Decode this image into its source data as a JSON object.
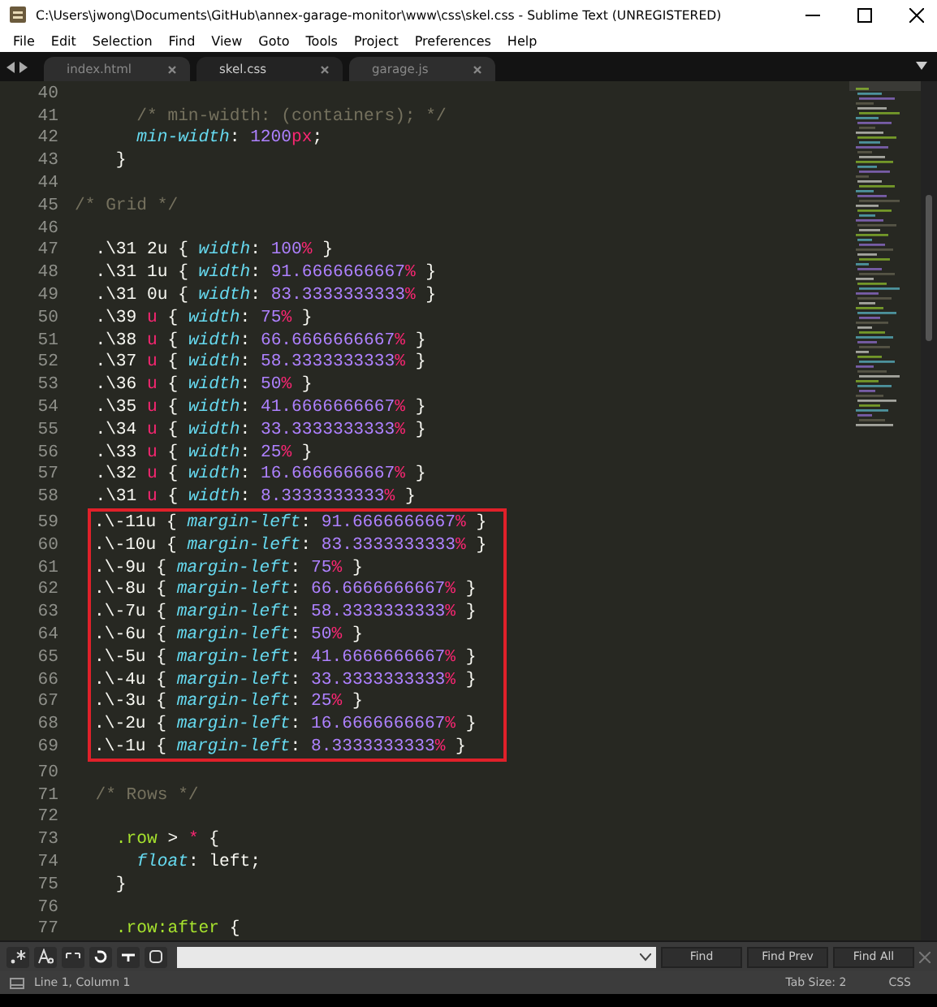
{
  "window": {
    "title": "C:\\Users\\jwong\\Documents\\GitHub\\annex-garage-monitor\\www\\css\\skel.css - Sublime Text (UNREGISTERED)"
  },
  "menu": [
    "File",
    "Edit",
    "Selection",
    "Find",
    "View",
    "Goto",
    "Tools",
    "Project",
    "Preferences",
    "Help"
  ],
  "tabs": [
    {
      "label": "index.html",
      "selected": false
    },
    {
      "label": "skel.css",
      "selected": true
    },
    {
      "label": "garage.js",
      "selected": false
    }
  ],
  "editor": {
    "lines": [
      {
        "number": "40",
        "boxed": false
      },
      {
        "number": "41",
        "boxed": false,
        "tokens": [
          {
            "kind": "comment",
            "text": "      /* min-width: (containers); */"
          }
        ]
      },
      {
        "number": "42",
        "boxed": false,
        "tokens": [
          {
            "kind": "property",
            "text": "      min-width"
          },
          {
            "kind": "plain",
            "text": ": "
          },
          {
            "kind": "number",
            "text": "1200"
          },
          {
            "kind": "unit",
            "text": "px"
          },
          {
            "kind": "plain",
            "text": ";"
          }
        ]
      },
      {
        "number": "43",
        "boxed": false,
        "tokens": [
          {
            "kind": "plain",
            "text": "    }"
          }
        ]
      },
      {
        "number": "44",
        "boxed": false
      },
      {
        "number": "45",
        "boxed": false,
        "tokens": [
          {
            "kind": "comment",
            "text": "/* Grid */"
          }
        ]
      },
      {
        "number": "46",
        "boxed": false
      },
      {
        "number": "47",
        "boxed": false,
        "tokens": [
          {
            "kind": "plain",
            "text": "  .\\31 2u { "
          },
          {
            "kind": "property",
            "text": "width"
          },
          {
            "kind": "plain",
            "text": ": "
          },
          {
            "kind": "number",
            "text": "100"
          },
          {
            "kind": "unit",
            "text": "%"
          },
          {
            "kind": "plain",
            "text": " }"
          }
        ]
      },
      {
        "number": "48",
        "boxed": false,
        "tokens": [
          {
            "kind": "plain",
            "text": "  .\\31 1u { "
          },
          {
            "kind": "property",
            "text": "width"
          },
          {
            "kind": "plain",
            "text": ": "
          },
          {
            "kind": "number",
            "text": "91.6666666667"
          },
          {
            "kind": "unit",
            "text": "%"
          },
          {
            "kind": "plain",
            "text": " }"
          }
        ]
      },
      {
        "number": "49",
        "boxed": false,
        "tokens": [
          {
            "kind": "plain",
            "text": "  .\\31 0u { "
          },
          {
            "kind": "property",
            "text": "width"
          },
          {
            "kind": "plain",
            "text": ": "
          },
          {
            "kind": "number",
            "text": "83.3333333333"
          },
          {
            "kind": "unit",
            "text": "%"
          },
          {
            "kind": "plain",
            "text": " }"
          }
        ]
      },
      {
        "number": "50",
        "boxed": false,
        "tokens": [
          {
            "kind": "plain",
            "text": "  .\\39 "
          },
          {
            "kind": "unit",
            "text": "u"
          },
          {
            "kind": "plain",
            "text": " { "
          },
          {
            "kind": "property",
            "text": "width"
          },
          {
            "kind": "plain",
            "text": ": "
          },
          {
            "kind": "number",
            "text": "75"
          },
          {
            "kind": "unit",
            "text": "%"
          },
          {
            "kind": "plain",
            "text": " }"
          }
        ]
      },
      {
        "number": "51",
        "boxed": false,
        "tokens": [
          {
            "kind": "plain",
            "text": "  .\\38 "
          },
          {
            "kind": "unit",
            "text": "u"
          },
          {
            "kind": "plain",
            "text": " { "
          },
          {
            "kind": "property",
            "text": "width"
          },
          {
            "kind": "plain",
            "text": ": "
          },
          {
            "kind": "number",
            "text": "66.6666666667"
          },
          {
            "kind": "unit",
            "text": "%"
          },
          {
            "kind": "plain",
            "text": " }"
          }
        ]
      },
      {
        "number": "52",
        "boxed": false,
        "tokens": [
          {
            "kind": "plain",
            "text": "  .\\37 "
          },
          {
            "kind": "unit",
            "text": "u"
          },
          {
            "kind": "plain",
            "text": " { "
          },
          {
            "kind": "property",
            "text": "width"
          },
          {
            "kind": "plain",
            "text": ": "
          },
          {
            "kind": "number",
            "text": "58.3333333333"
          },
          {
            "kind": "unit",
            "text": "%"
          },
          {
            "kind": "plain",
            "text": " }"
          }
        ]
      },
      {
        "number": "53",
        "boxed": false,
        "tokens": [
          {
            "kind": "plain",
            "text": "  .\\36 "
          },
          {
            "kind": "unit",
            "text": "u"
          },
          {
            "kind": "plain",
            "text": " { "
          },
          {
            "kind": "property",
            "text": "width"
          },
          {
            "kind": "plain",
            "text": ": "
          },
          {
            "kind": "number",
            "text": "50"
          },
          {
            "kind": "unit",
            "text": "%"
          },
          {
            "kind": "plain",
            "text": " }"
          }
        ]
      },
      {
        "number": "54",
        "boxed": false,
        "tokens": [
          {
            "kind": "plain",
            "text": "  .\\35 "
          },
          {
            "kind": "unit",
            "text": "u"
          },
          {
            "kind": "plain",
            "text": " { "
          },
          {
            "kind": "property",
            "text": "width"
          },
          {
            "kind": "plain",
            "text": ": "
          },
          {
            "kind": "number",
            "text": "41.6666666667"
          },
          {
            "kind": "unit",
            "text": "%"
          },
          {
            "kind": "plain",
            "text": " }"
          }
        ]
      },
      {
        "number": "55",
        "boxed": false,
        "tokens": [
          {
            "kind": "plain",
            "text": "  .\\34 "
          },
          {
            "kind": "unit",
            "text": "u"
          },
          {
            "kind": "plain",
            "text": " { "
          },
          {
            "kind": "property",
            "text": "width"
          },
          {
            "kind": "plain",
            "text": ": "
          },
          {
            "kind": "number",
            "text": "33.3333333333"
          },
          {
            "kind": "unit",
            "text": "%"
          },
          {
            "kind": "plain",
            "text": " }"
          }
        ]
      },
      {
        "number": "56",
        "boxed": false,
        "tokens": [
          {
            "kind": "plain",
            "text": "  .\\33 "
          },
          {
            "kind": "unit",
            "text": "u"
          },
          {
            "kind": "plain",
            "text": " { "
          },
          {
            "kind": "property",
            "text": "width"
          },
          {
            "kind": "plain",
            "text": ": "
          },
          {
            "kind": "number",
            "text": "25"
          },
          {
            "kind": "unit",
            "text": "%"
          },
          {
            "kind": "plain",
            "text": " }"
          }
        ]
      },
      {
        "number": "57",
        "boxed": false,
        "tokens": [
          {
            "kind": "plain",
            "text": "  .\\32 "
          },
          {
            "kind": "unit",
            "text": "u"
          },
          {
            "kind": "plain",
            "text": " { "
          },
          {
            "kind": "property",
            "text": "width"
          },
          {
            "kind": "plain",
            "text": ": "
          },
          {
            "kind": "number",
            "text": "16.6666666667"
          },
          {
            "kind": "unit",
            "text": "%"
          },
          {
            "kind": "plain",
            "text": " }"
          }
        ]
      },
      {
        "number": "58",
        "boxed": false,
        "tokens": [
          {
            "kind": "plain",
            "text": "  .\\31 "
          },
          {
            "kind": "unit",
            "text": "u"
          },
          {
            "kind": "plain",
            "text": " { "
          },
          {
            "kind": "property",
            "text": "width"
          },
          {
            "kind": "plain",
            "text": ": "
          },
          {
            "kind": "number",
            "text": "8.3333333333"
          },
          {
            "kind": "unit",
            "text": "%"
          },
          {
            "kind": "plain",
            "text": " }"
          }
        ]
      },
      {
        "number": "59",
        "boxed": true,
        "tokens": [
          {
            "kind": "plain",
            "text": ".\\-11u { "
          },
          {
            "kind": "property",
            "text": "margin-left"
          },
          {
            "kind": "plain",
            "text": ": "
          },
          {
            "kind": "number",
            "text": "91.6666666667"
          },
          {
            "kind": "unit",
            "text": "%"
          },
          {
            "kind": "plain",
            "text": " }"
          }
        ]
      },
      {
        "number": "60",
        "boxed": true,
        "tokens": [
          {
            "kind": "plain",
            "text": ".\\-10u { "
          },
          {
            "kind": "property",
            "text": "margin-left"
          },
          {
            "kind": "plain",
            "text": ": "
          },
          {
            "kind": "number",
            "text": "83.3333333333"
          },
          {
            "kind": "unit",
            "text": "%"
          },
          {
            "kind": "plain",
            "text": " }"
          }
        ]
      },
      {
        "number": "61",
        "boxed": true,
        "tokens": [
          {
            "kind": "plain",
            "text": ".\\-9u { "
          },
          {
            "kind": "property",
            "text": "margin-left"
          },
          {
            "kind": "plain",
            "text": ": "
          },
          {
            "kind": "number",
            "text": "75"
          },
          {
            "kind": "unit",
            "text": "%"
          },
          {
            "kind": "plain",
            "text": " }"
          }
        ]
      },
      {
        "number": "62",
        "boxed": true,
        "tokens": [
          {
            "kind": "plain",
            "text": ".\\-8u { "
          },
          {
            "kind": "property",
            "text": "margin-left"
          },
          {
            "kind": "plain",
            "text": ": "
          },
          {
            "kind": "number",
            "text": "66.6666666667"
          },
          {
            "kind": "unit",
            "text": "%"
          },
          {
            "kind": "plain",
            "text": " }"
          }
        ]
      },
      {
        "number": "63",
        "boxed": true,
        "tokens": [
          {
            "kind": "plain",
            "text": ".\\-7u { "
          },
          {
            "kind": "property",
            "text": "margin-left"
          },
          {
            "kind": "plain",
            "text": ": "
          },
          {
            "kind": "number",
            "text": "58.3333333333"
          },
          {
            "kind": "unit",
            "text": "%"
          },
          {
            "kind": "plain",
            "text": " }"
          }
        ]
      },
      {
        "number": "64",
        "boxed": true,
        "tokens": [
          {
            "kind": "plain",
            "text": ".\\-6u { "
          },
          {
            "kind": "property",
            "text": "margin-left"
          },
          {
            "kind": "plain",
            "text": ": "
          },
          {
            "kind": "number",
            "text": "50"
          },
          {
            "kind": "unit",
            "text": "%"
          },
          {
            "kind": "plain",
            "text": " }"
          }
        ]
      },
      {
        "number": "65",
        "boxed": true,
        "tokens": [
          {
            "kind": "plain",
            "text": ".\\-5u { "
          },
          {
            "kind": "property",
            "text": "margin-left"
          },
          {
            "kind": "plain",
            "text": ": "
          },
          {
            "kind": "number",
            "text": "41.6666666667"
          },
          {
            "kind": "unit",
            "text": "%"
          },
          {
            "kind": "plain",
            "text": " }"
          }
        ]
      },
      {
        "number": "66",
        "boxed": true,
        "tokens": [
          {
            "kind": "plain",
            "text": ".\\-4u { "
          },
          {
            "kind": "property",
            "text": "margin-left"
          },
          {
            "kind": "plain",
            "text": ": "
          },
          {
            "kind": "number",
            "text": "33.3333333333"
          },
          {
            "kind": "unit",
            "text": "%"
          },
          {
            "kind": "plain",
            "text": " }"
          }
        ]
      },
      {
        "number": "67",
        "boxed": true,
        "tokens": [
          {
            "kind": "plain",
            "text": ".\\-3u { "
          },
          {
            "kind": "property",
            "text": "margin-left"
          },
          {
            "kind": "plain",
            "text": ": "
          },
          {
            "kind": "number",
            "text": "25"
          },
          {
            "kind": "unit",
            "text": "%"
          },
          {
            "kind": "plain",
            "text": " }"
          }
        ]
      },
      {
        "number": "68",
        "boxed": true,
        "tokens": [
          {
            "kind": "plain",
            "text": ".\\-2u { "
          },
          {
            "kind": "property",
            "text": "margin-left"
          },
          {
            "kind": "plain",
            "text": ": "
          },
          {
            "kind": "number",
            "text": "16.6666666667"
          },
          {
            "kind": "unit",
            "text": "%"
          },
          {
            "kind": "plain",
            "text": " }"
          }
        ]
      },
      {
        "number": "69",
        "boxed": true,
        "tokens": [
          {
            "kind": "plain",
            "text": ".\\-1u { "
          },
          {
            "kind": "property",
            "text": "margin-left"
          },
          {
            "kind": "plain",
            "text": ": "
          },
          {
            "kind": "number",
            "text": "8.3333333333"
          },
          {
            "kind": "unit",
            "text": "%"
          },
          {
            "kind": "plain",
            "text": " }"
          }
        ]
      },
      {
        "number": "70",
        "boxed": false
      },
      {
        "number": "71",
        "boxed": false,
        "tokens": [
          {
            "kind": "comment",
            "text": "  /* Rows */"
          }
        ]
      },
      {
        "number": "72",
        "boxed": false
      },
      {
        "number": "73",
        "boxed": false,
        "tokens": [
          {
            "kind": "selector",
            "text": "    .row"
          },
          {
            "kind": "plain",
            "text": " > "
          },
          {
            "kind": "unit",
            "text": "*"
          },
          {
            "kind": "plain",
            "text": " {"
          }
        ]
      },
      {
        "number": "74",
        "boxed": false,
        "tokens": [
          {
            "kind": "property",
            "text": "      float"
          },
          {
            "kind": "plain",
            "text": ": left;"
          }
        ]
      },
      {
        "number": "75",
        "boxed": false,
        "tokens": [
          {
            "kind": "plain",
            "text": "    }"
          }
        ]
      },
      {
        "number": "76",
        "boxed": false
      },
      {
        "number": "77",
        "boxed": false,
        "tokens": [
          {
            "kind": "selector",
            "text": "    .row:after"
          },
          {
            "kind": "plain",
            "text": " {"
          }
        ]
      }
    ]
  },
  "find_panel": {
    "buttons": [
      "Find",
      "Find Prev",
      "Find All"
    ]
  },
  "status_bar": {
    "position": "Line 1, Column 1",
    "tab_size": "Tab Size: 2",
    "syntax": "CSS"
  }
}
